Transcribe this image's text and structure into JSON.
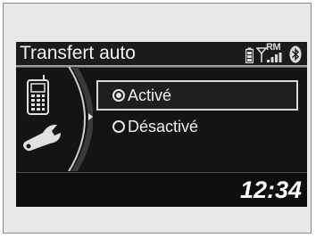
{
  "header": {
    "title": "Transfert auto",
    "status_icons": [
      "battery-icon",
      "signal-icon",
      "bluetooth-icon"
    ],
    "roaming_label": "RM"
  },
  "side_panel": {
    "icons": [
      "phone-icon",
      "wrench-icon"
    ]
  },
  "options": [
    {
      "label": "Activé",
      "selected": true
    },
    {
      "label": "Désactivé",
      "selected": false
    }
  ],
  "footer": {
    "clock": "12:34"
  },
  "colors": {
    "screen_bg": "#151515",
    "text": "#f0f0f0",
    "frame_bg": "#e8e8e8"
  }
}
